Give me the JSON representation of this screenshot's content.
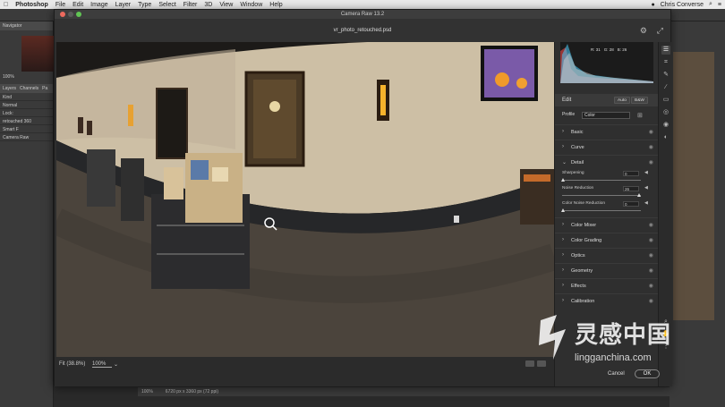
{
  "menubar": {
    "apple": "",
    "app": "Photoshop",
    "items": [
      "File",
      "Edit",
      "Image",
      "Layer",
      "Type",
      "Select",
      "Filter",
      "3D",
      "View",
      "Window",
      "Help"
    ],
    "user": "Chris Converse"
  },
  "ps_left": {
    "navigator_tab": "Navigator",
    "zoom": "100%",
    "layers_tabs": [
      "Layers",
      "Channels",
      "Pa"
    ],
    "kind": "Kind",
    "blend": "Normal",
    "lock": "Lock:",
    "layer_name": "retouched 360",
    "smart_filters": "Smart F",
    "camera_raw": "Camera Raw"
  },
  "ps_status": {
    "zoom": "100%",
    "doc_info": "6720 px x 3360 px (72 ppi)"
  },
  "dialog": {
    "title": "Camera Raw 13.2",
    "filename": "vr_photo_retouched.psd",
    "fit_label": "Fit (38.8%)",
    "zoom_value": "100%",
    "cancel": "Cancel",
    "ok": "OK"
  },
  "panel": {
    "histogram": {
      "r": "R: 31",
      "g": "G: 28",
      "b": "B: 26"
    },
    "edit_label": "Edit",
    "auto_btn": "Auto",
    "bw_btn": "B&W",
    "profile_label": "Profile",
    "profile_value": "Color",
    "sections_top": [
      {
        "name": "Basic"
      },
      {
        "name": "Curve"
      },
      {
        "name": "Detail"
      }
    ],
    "sliders": [
      {
        "label": "Sharpening",
        "value": "0",
        "level": 0
      },
      {
        "label": "Noise Reduction",
        "value": "26",
        "level": 26
      },
      {
        "label": "Color Noise Reduction",
        "value": "0",
        "level": 0
      }
    ],
    "sections_bottom": [
      {
        "name": "Color Mixer"
      },
      {
        "name": "Color Grading"
      },
      {
        "name": "Optics"
      },
      {
        "name": "Geometry"
      },
      {
        "name": "Effects"
      },
      {
        "name": "Calibration"
      }
    ]
  },
  "watermark": {
    "cn": "灵感中国",
    "url": "lingganchina.com"
  },
  "colors": {
    "wall": "#c9bca4",
    "floor": "#4a433b",
    "wainscot": "#26272a",
    "ok_border": "#888888"
  }
}
